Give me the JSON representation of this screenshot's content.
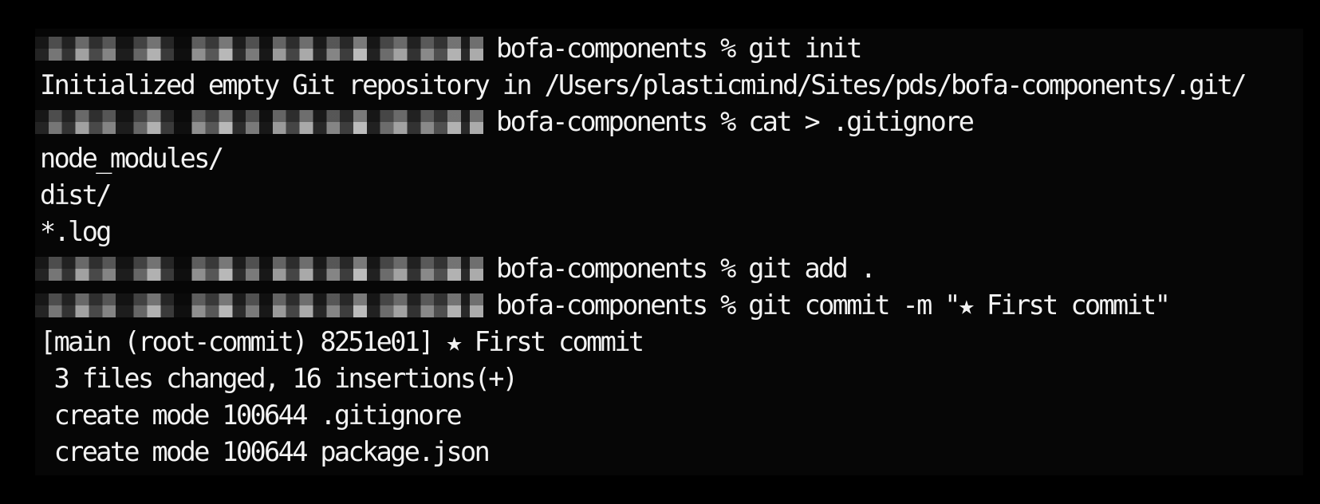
{
  "terminal": {
    "prompt_dir": "bofa-components %",
    "lines": [
      {
        "kind": "command",
        "text": " git init"
      },
      {
        "kind": "output",
        "text": "Initialized empty Git repository in /Users/plasticmind/Sites/pds/bofa-components/.git/"
      },
      {
        "kind": "command",
        "text": " cat > .gitignore"
      },
      {
        "kind": "output",
        "text": "node_modules/"
      },
      {
        "kind": "output",
        "text": "dist/"
      },
      {
        "kind": "output",
        "text": "*.log"
      },
      {
        "kind": "command",
        "text": " git add ."
      },
      {
        "kind": "command",
        "text": " git commit -m \"★ First commit\""
      },
      {
        "kind": "output",
        "text": "[main (root-commit) 8251e01] ★ First commit"
      },
      {
        "kind": "output",
        "text": " 3 files changed, 16 insertions(+)"
      },
      {
        "kind": "output",
        "text": " create mode 100644 .gitignore"
      },
      {
        "kind": "output",
        "text": " create mode 100644 package.json"
      }
    ]
  }
}
